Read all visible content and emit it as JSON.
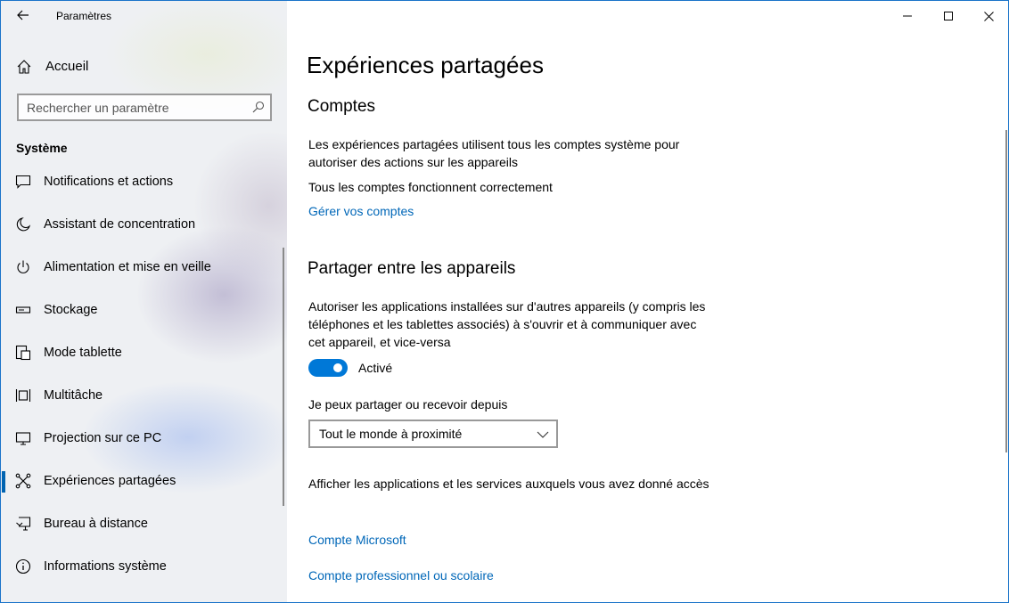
{
  "window": {
    "title": "Paramètres"
  },
  "sidebar": {
    "home_label": "Accueil",
    "search_placeholder": "Rechercher un paramètre",
    "section_title": "Système",
    "items": [
      {
        "label": "Notifications et actions",
        "icon": "notification-icon"
      },
      {
        "label": "Assistant de concentration",
        "icon": "moon-icon"
      },
      {
        "label": "Alimentation et mise en veille",
        "icon": "power-icon"
      },
      {
        "label": "Stockage",
        "icon": "storage-icon"
      },
      {
        "label": "Mode tablette",
        "icon": "tablet-icon"
      },
      {
        "label": "Multitâche",
        "icon": "multitask-icon"
      },
      {
        "label": "Projection sur ce PC",
        "icon": "projection-icon"
      },
      {
        "label": "Expériences partagées",
        "icon": "shared-icon",
        "active": true
      },
      {
        "label": "Bureau à distance",
        "icon": "remote-desktop-icon"
      },
      {
        "label": "Informations système",
        "icon": "info-icon"
      }
    ]
  },
  "main": {
    "page_title": "Expériences partagées",
    "accounts": {
      "heading": "Comptes",
      "description": "Les expériences partagées utilisent tous les comptes système pour autoriser des actions sur les appareils",
      "status": "Tous les comptes fonctionnent correctement",
      "manage_link": "Gérer vos comptes"
    },
    "share": {
      "heading": "Partager entre les appareils",
      "description": "Autoriser les applications installées sur d'autres appareils (y compris les téléphones et les tablettes associés) à s'ouvrir et à communiquer avec cet appareil, et vice-versa",
      "toggle_state": "Activé",
      "toggle_on": true,
      "receive_label": "Je peux partager ou recevoir depuis",
      "receive_value": "Tout le monde à proximité",
      "apps_description": "Afficher les applications et les services auxquels vous avez donné accès",
      "link_microsoft": "Compte Microsoft",
      "link_work": "Compte professionnel ou scolaire"
    }
  },
  "colors": {
    "accent": "#0078d7",
    "link": "#0067b8",
    "active_bar": "#0063b1"
  }
}
